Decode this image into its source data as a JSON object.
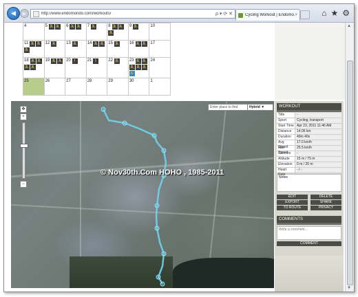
{
  "browser": {
    "url": "http://www.endomondo.com/workouts/",
    "tab_title": "Cycling Workout | Endomo...",
    "tab_close": "×",
    "addr_controls": "ρ ▾ ⟳ ✕",
    "back": "◀",
    "forward": "▶",
    "home_icon": "⌂",
    "star_icon": "★",
    "gear_icon": "⚙"
  },
  "calendar": {
    "rows": [
      [
        {
          "d": "4",
          "w": []
        },
        {
          "d": "5",
          "w": [
            "🚴",
            "🚴"
          ]
        },
        {
          "d": "6",
          "w": [
            "🚴",
            "🚴"
          ]
        },
        {
          "d": "7",
          "w": [
            "🚴"
          ]
        },
        {
          "d": "8",
          "w": [
            "🚴",
            "🚴",
            "🚴"
          ]
        },
        {
          "d": "9",
          "w": [
            "🚴"
          ]
        },
        {
          "d": "10",
          "w": []
        }
      ],
      [
        {
          "d": "11",
          "w": [
            "🚴",
            "🚴",
            "🚴"
          ]
        },
        {
          "d": "12",
          "w": [
            "🚴"
          ]
        },
        {
          "d": "13",
          "w": [
            "🚴"
          ]
        },
        {
          "d": "14",
          "w": [
            "🚴",
            "🚴"
          ]
        },
        {
          "d": "15",
          "w": [
            "🚴"
          ]
        },
        {
          "d": "16",
          "w": [
            "🚴",
            "🚴"
          ]
        },
        {
          "d": "17",
          "w": []
        }
      ],
      [
        {
          "d": "18",
          "w": [
            "🚴",
            "🚴",
            "🚴",
            "🚴"
          ]
        },
        {
          "d": "19",
          "w": [
            "🚴",
            "🚴"
          ]
        },
        {
          "d": "20",
          "w": [
            "🚶"
          ]
        },
        {
          "d": "21",
          "w": [
            "🚶"
          ]
        },
        {
          "d": "22",
          "w": [
            "🚴"
          ]
        },
        {
          "d": "23",
          "w": [
            "🚴",
            "🚴",
            "🚴",
            "🚴",
            "🚴",
            "🚴"
          ]
        },
        {
          "d": "24",
          "w": []
        }
      ],
      [
        {
          "d": "25",
          "w": []
        },
        {
          "d": "26",
          "w": []
        },
        {
          "d": "27",
          "w": []
        },
        {
          "d": "28",
          "w": []
        },
        {
          "d": "29",
          "w": []
        },
        {
          "d": "30",
          "w": []
        },
        {
          "d": "1",
          "w": []
        }
      ]
    ],
    "selected_cell": "23",
    "today_cell": "25"
  },
  "map": {
    "search_placeholder": "Enter place to find",
    "map_type": "Hybrid ▼",
    "zoom_in": "+",
    "zoom_out": "−",
    "watermark": "© Nov30th.Com HOHO  , 1985-2011"
  },
  "workout": {
    "header": "WORKOUT",
    "fields": [
      {
        "k": "Title",
        "v": "-"
      },
      {
        "k": "Sport",
        "v": "Cycling, transport"
      },
      {
        "k": "Start Time",
        "v": "Apr 23, 2011 11:46 AM"
      },
      {
        "k": "Distance",
        "v": "14.06 km"
      },
      {
        "k": "Duration",
        "v": "49m 40s"
      },
      {
        "k": "Avg Speed",
        "v": "17.0 km/h"
      },
      {
        "k": "Max Speed",
        "v": "25.5 km/h"
      },
      {
        "k": "Calories",
        "v": "-"
      },
      {
        "k": "Altitude",
        "v": "15 m / 75 m"
      },
      {
        "k": "Elevation",
        "v": "0 m / 20 m"
      },
      {
        "k": "Heart Rate",
        "v": "- / -"
      }
    ],
    "notes_label": "Notes",
    "buttons": [
      "EDIT",
      "DELETE",
      "EXPORT",
      "SHARE",
      "TO ROUTE",
      "PRIVACY"
    ]
  },
  "comments": {
    "header": "COMMENTS",
    "placeholder": "Write a comment...",
    "button": "COMMENT"
  },
  "colors": {
    "route": "#6fd3ef",
    "panel_header": "#4b4c46"
  }
}
